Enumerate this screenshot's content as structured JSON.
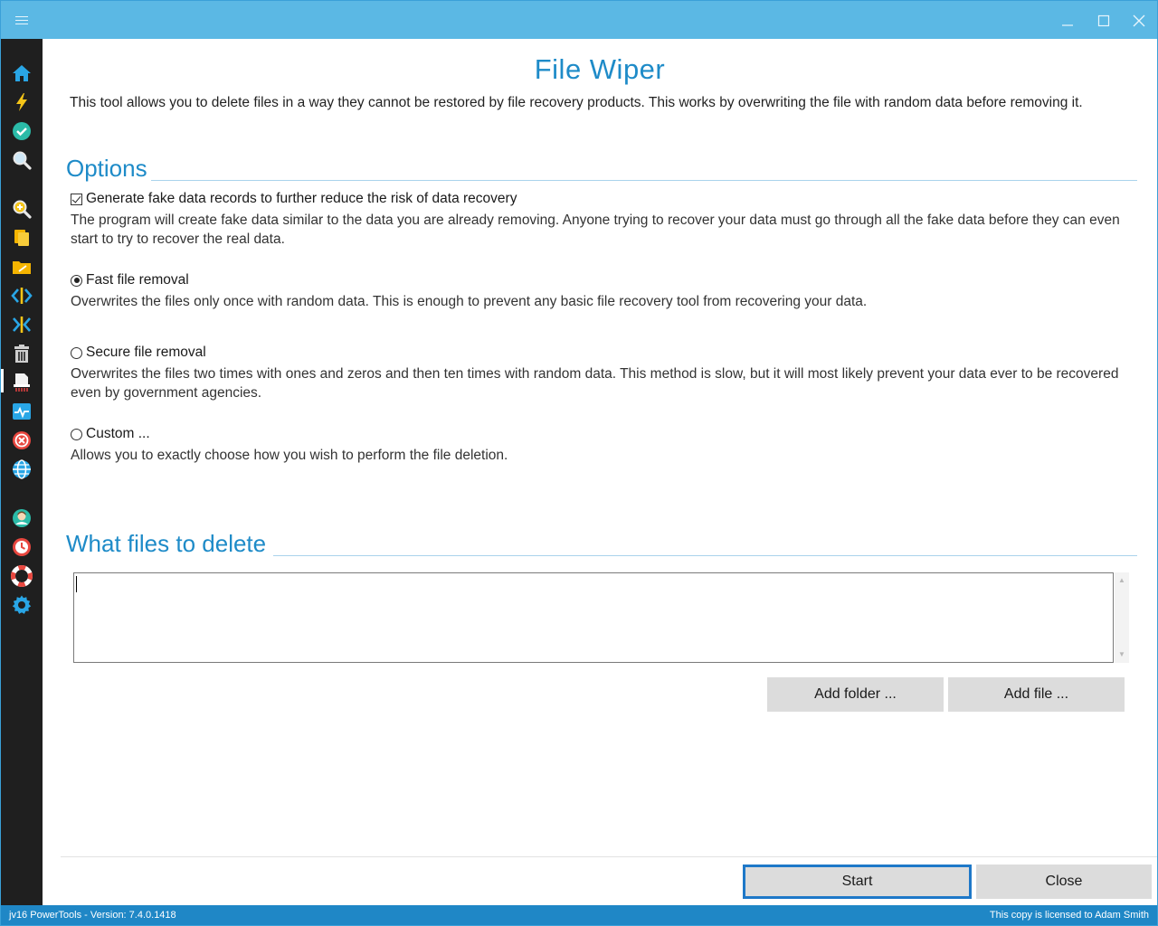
{
  "title": "File Wiper",
  "intro": "This tool allows you to delete files in a way they cannot be restored by file recovery products. This works by overwriting the file with random data before removing it.",
  "options": {
    "heading": "Options",
    "fake_data": {
      "label": "Generate fake data records to further reduce the risk of data recovery",
      "checked": true,
      "desc": "The program will create fake data similar to the data you are already removing. Anyone trying to recover your data must go through all the fake data before they can even start to try to recover the real data."
    },
    "fast": {
      "label": "Fast file removal",
      "selected": true,
      "desc": "Overwrites the files only once with random data. This is enough to prevent any basic file recovery tool from recovering your data."
    },
    "secure": {
      "label": "Secure file removal",
      "selected": false,
      "desc": "Overwrites the files two times with ones and zeros and then ten times with random data. This method is slow, but it will most likely prevent your data ever to be recovered even by government agencies."
    },
    "custom": {
      "label": "Custom ...",
      "selected": false,
      "desc": "Allows you to exactly choose how you wish to perform the file deletion."
    }
  },
  "files": {
    "heading": "What files to delete",
    "value": "",
    "add_folder": "Add folder ...",
    "add_file": "Add file ..."
  },
  "actions": {
    "start": "Start",
    "close": "Close"
  },
  "status": {
    "left": "jv16 PowerTools - Version: 7.4.0.1418",
    "right": "This copy is licensed to Adam Smith"
  },
  "colors": {
    "titlebar": "#5bb8e4",
    "sidebar": "#1f1f1f",
    "accent": "#1e8bc8",
    "statusbar": "#1f87c6"
  },
  "sidebar_icons": [
    "home-icon",
    "lightning-icon",
    "checkmark-icon",
    "search-icon",
    "zoom-in-icon",
    "documents-icon",
    "folder-icon",
    "split-icon",
    "merge-icon",
    "trash-icon",
    "file-shredder-icon",
    "system-monitor-icon",
    "error-icon",
    "globe-icon",
    "user-icon",
    "clock-icon",
    "lifebuoy-icon",
    "settings-icon"
  ]
}
